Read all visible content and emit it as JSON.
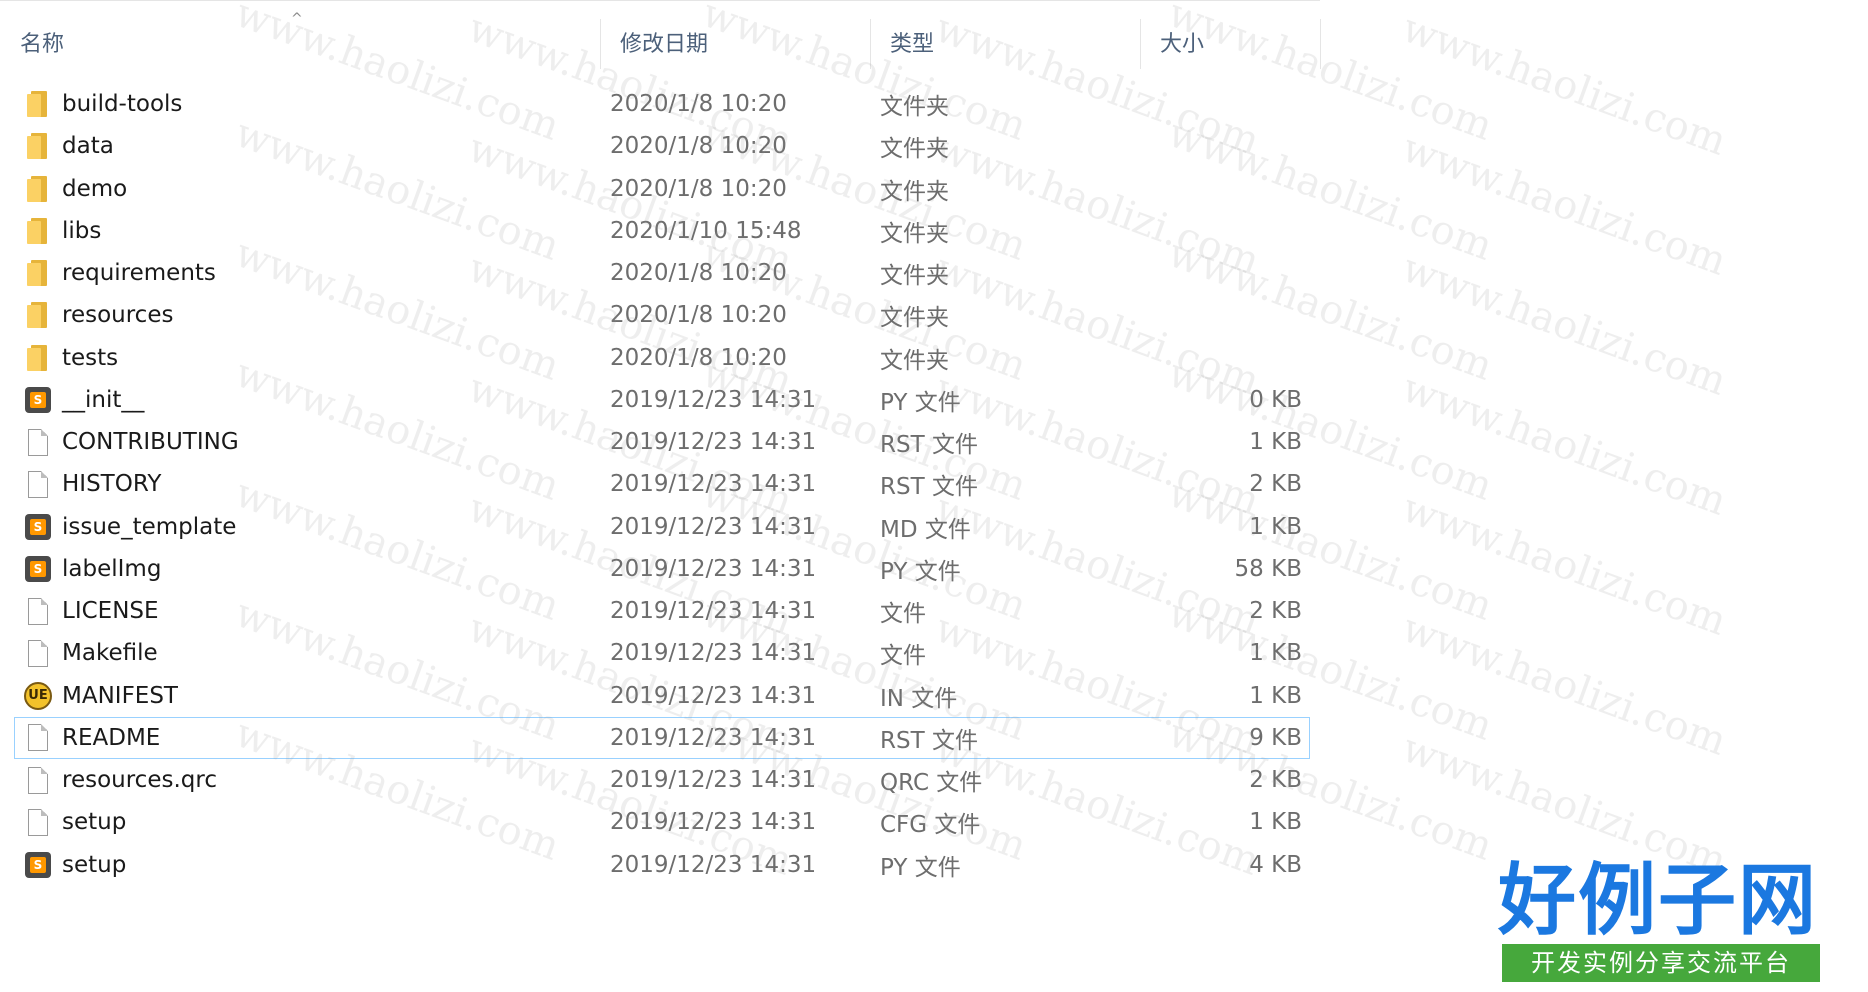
{
  "columns": {
    "name": "名称",
    "date": "修改日期",
    "type": "类型",
    "size": "大小"
  },
  "sort_indicator": "^",
  "files": [
    {
      "name": "build-tools",
      "date": "2020/1/8 10:20",
      "type": "文件夹",
      "size": "",
      "icon": "folder-icon"
    },
    {
      "name": "data",
      "date": "2020/1/8 10:20",
      "type": "文件夹",
      "size": "",
      "icon": "folder-icon"
    },
    {
      "name": "demo",
      "date": "2020/1/8 10:20",
      "type": "文件夹",
      "size": "",
      "icon": "folder-icon"
    },
    {
      "name": "libs",
      "date": "2020/1/10 15:48",
      "type": "文件夹",
      "size": "",
      "icon": "folder-icon"
    },
    {
      "name": "requirements",
      "date": "2020/1/8 10:20",
      "type": "文件夹",
      "size": "",
      "icon": "folder-icon"
    },
    {
      "name": "resources",
      "date": "2020/1/8 10:20",
      "type": "文件夹",
      "size": "",
      "icon": "folder-icon"
    },
    {
      "name": "tests",
      "date": "2020/1/8 10:20",
      "type": "文件夹",
      "size": "",
      "icon": "folder-icon"
    },
    {
      "name": "__init__",
      "date": "2019/12/23 14:31",
      "type": "PY 文件",
      "size": "0 KB",
      "icon": "sublime-file-icon"
    },
    {
      "name": "CONTRIBUTING",
      "date": "2019/12/23 14:31",
      "type": "RST 文件",
      "size": "1 KB",
      "icon": "blank-file-icon"
    },
    {
      "name": "HISTORY",
      "date": "2019/12/23 14:31",
      "type": "RST 文件",
      "size": "2 KB",
      "icon": "blank-file-icon"
    },
    {
      "name": "issue_template",
      "date": "2019/12/23 14:31",
      "type": "MD 文件",
      "size": "1 KB",
      "icon": "sublime-file-icon"
    },
    {
      "name": "labelImg",
      "date": "2019/12/23 14:31",
      "type": "PY 文件",
      "size": "58 KB",
      "icon": "sublime-file-icon"
    },
    {
      "name": "LICENSE",
      "date": "2019/12/23 14:31",
      "type": "文件",
      "size": "2 KB",
      "icon": "blank-file-icon"
    },
    {
      "name": "Makefile",
      "date": "2019/12/23 14:31",
      "type": "文件",
      "size": "1 KB",
      "icon": "blank-file-icon"
    },
    {
      "name": "MANIFEST",
      "date": "2019/12/23 14:31",
      "type": "IN 文件",
      "size": "1 KB",
      "icon": "ultraedit-file-icon"
    },
    {
      "name": "README",
      "date": "2019/12/23 14:31",
      "type": "RST 文件",
      "size": "9 KB",
      "icon": "blank-file-icon",
      "selected": true
    },
    {
      "name": "resources.qrc",
      "date": "2019/12/23 14:31",
      "type": "QRC 文件",
      "size": "2 KB",
      "icon": "blank-file-icon"
    },
    {
      "name": "setup",
      "date": "2019/12/23 14:31",
      "type": "CFG 文件",
      "size": "1 KB",
      "icon": "blank-file-icon"
    },
    {
      "name": "setup",
      "date": "2019/12/23 14:31",
      "type": "PY 文件",
      "size": "4 KB",
      "icon": "sublime-file-icon"
    }
  ],
  "watermark_text": "www.haolizi.com",
  "logo": {
    "title": "好例子网",
    "subtitle": "开发实例分享交流平台"
  },
  "colors": {
    "header_text": "#4c607a",
    "name_text": "#1a1a1a",
    "meta_text": "#6d6d6d",
    "selection_border": "#99d1ff",
    "logo_blue": "#1b78e0",
    "logo_green": "#46a83c"
  }
}
